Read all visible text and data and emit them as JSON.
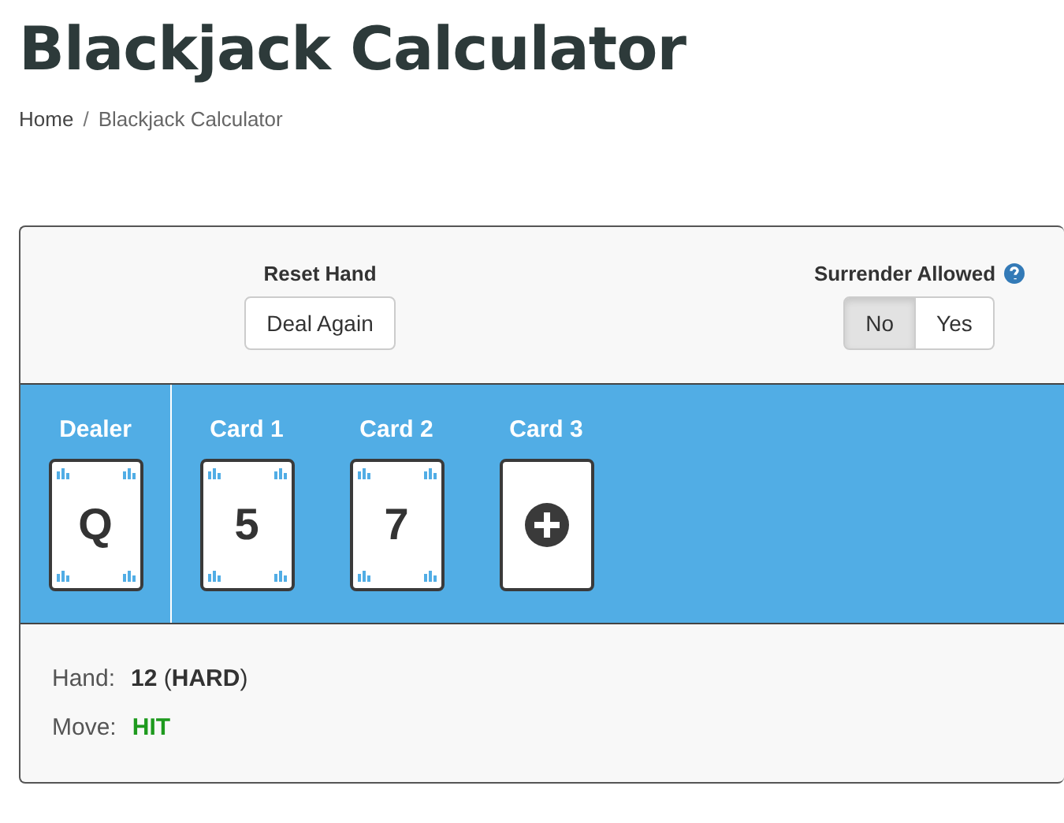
{
  "title": "Blackjack Calculator",
  "breadcrumb": {
    "items": [
      "Home",
      "Blackjack Calculator"
    ],
    "separator": "/"
  },
  "reset": {
    "label": "Reset Hand",
    "button": "Deal Again"
  },
  "surrender": {
    "label": "Surrender Allowed",
    "options": [
      {
        "label": "No",
        "selected": true
      },
      {
        "label": "Yes",
        "selected": false
      }
    ]
  },
  "dealer": {
    "label": "Dealer",
    "card": {
      "kind": "card",
      "value": "Q"
    }
  },
  "cards": [
    {
      "label": "Card 1",
      "kind": "card",
      "value": "5"
    },
    {
      "label": "Card 2",
      "kind": "card",
      "value": "7"
    },
    {
      "label": "Card 3",
      "kind": "add"
    }
  ],
  "result": [
    {
      "label": "Hand:",
      "value": "**12** (**HARD**)",
      "kind": "plain"
    },
    {
      "label": "Move:",
      "value": "HIT",
      "kind": "move"
    }
  ]
}
